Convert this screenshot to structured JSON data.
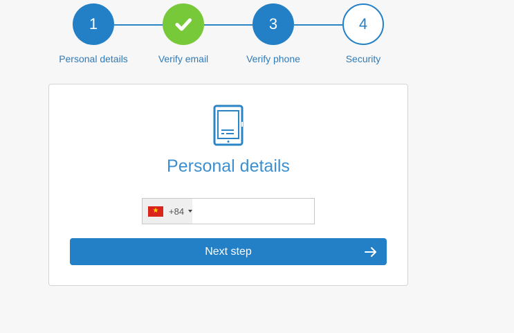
{
  "stepper": {
    "steps": [
      {
        "number": "1",
        "label": "Personal details",
        "state": "active"
      },
      {
        "number": "",
        "label": "Verify email",
        "state": "completed",
        "icon": "check-icon"
      },
      {
        "number": "3",
        "label": "Verify phone",
        "state": "active"
      },
      {
        "number": "4",
        "label": "Security",
        "state": "pending"
      }
    ]
  },
  "card": {
    "icon": "phone-icon",
    "title": "Personal details",
    "phone_field": {
      "country_flag": "vietnam-flag-icon",
      "dial_code": "+84",
      "value": "",
      "placeholder": ""
    },
    "next_button_label": "Next step",
    "next_button_icon": "arrow-right-icon"
  },
  "colors": {
    "primary": "#2380c6",
    "success": "#78c93a",
    "label_text": "#2f7ab8",
    "title_text": "#3d8fcf",
    "background": "#f7f7f7"
  }
}
